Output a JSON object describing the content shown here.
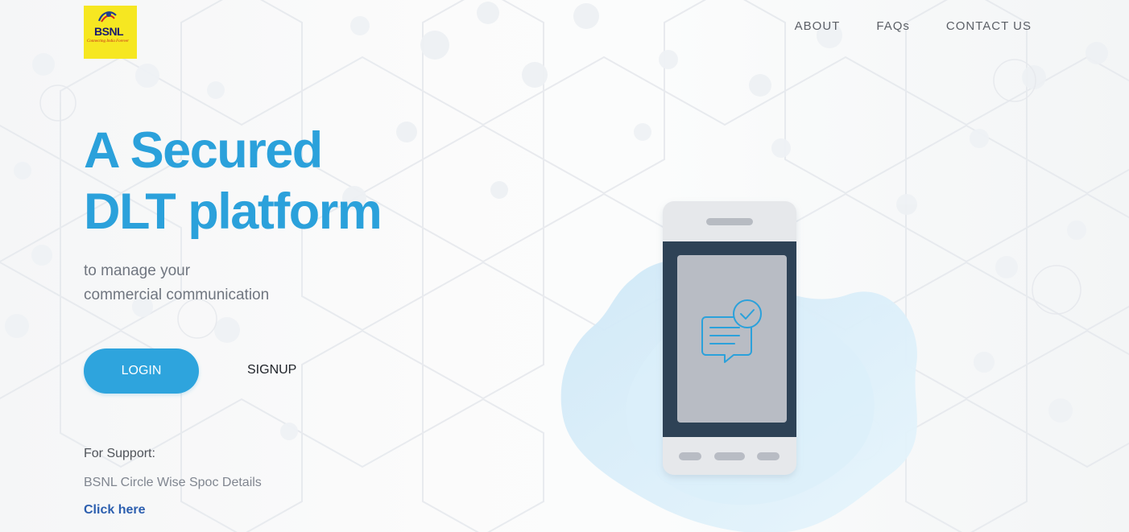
{
  "brand": {
    "name": "BSNL",
    "tagline": "Connecting India Forever"
  },
  "nav": {
    "items": [
      {
        "label": "ABOUT"
      },
      {
        "label": "FAQs"
      },
      {
        "label": "CONTACT US"
      }
    ]
  },
  "hero": {
    "headline_line1": "A Secured",
    "headline_line2": "DLT platform",
    "subhead_line1": "to manage your",
    "subhead_line2": "commercial communication"
  },
  "actions": {
    "login_label": "LOGIN",
    "signup_label": "SIGNUP"
  },
  "support": {
    "title": "For Support:",
    "description": "BSNL Circle Wise Spoc Details",
    "link_label": "Click here"
  },
  "colors": {
    "accent": "#2ba1db",
    "button": "#2ea4dd",
    "link": "#2c5faf",
    "logo_yellow": "#f6e721",
    "phone_body": "#2f4257",
    "screen": "#b8bcc4"
  },
  "icons": {
    "logo": "bsnl-logo",
    "phone": "mobile-phone-icon",
    "message": "message-check-icon"
  }
}
